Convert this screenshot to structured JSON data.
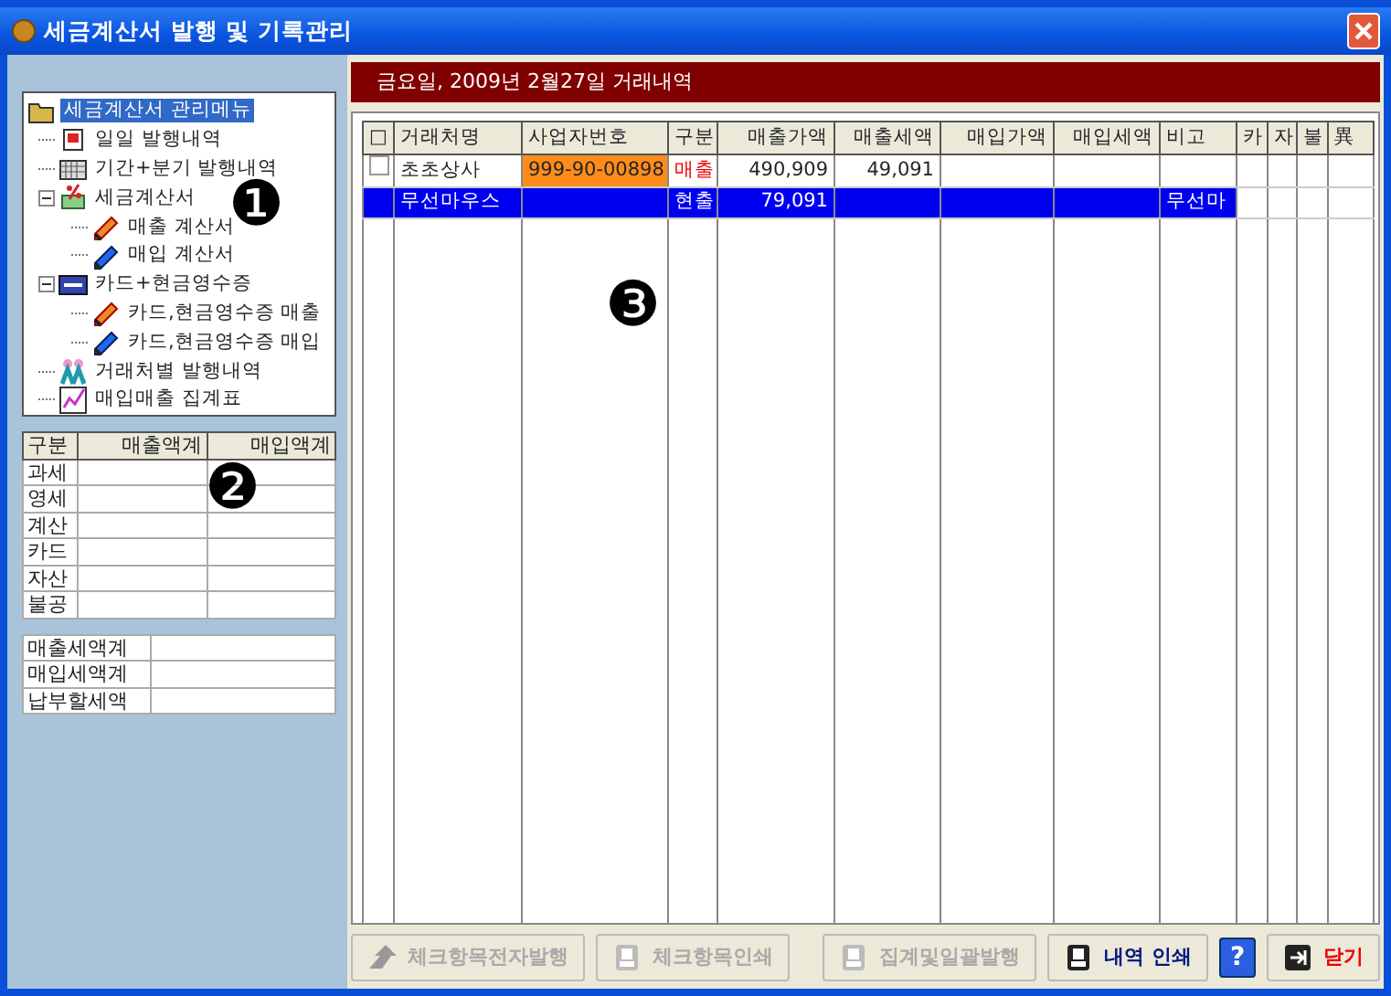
{
  "window": {
    "title": "세금계산서 발행 및 기록관리"
  },
  "tree": [
    {
      "label": "세금계산서 관리메뉴",
      "selected": true,
      "children": [
        {
          "label": "일일 발행내역",
          "selected": false
        },
        {
          "label": "기간+분기 발행내역",
          "selected": false
        },
        {
          "label": "세금계산서",
          "selected": false,
          "expanded": true,
          "children": [
            {
              "label": "매출 계산서",
              "selected": false
            },
            {
              "label": "매입 계산서",
              "selected": false
            }
          ]
        },
        {
          "label": "카드+현금영수증",
          "selected": false,
          "expanded": true,
          "children": [
            {
              "label": "카드,현금영수증 매출",
              "selected": false
            },
            {
              "label": "카드,현금영수증 매입",
              "selected": false
            }
          ]
        },
        {
          "label": "거래처별 발행내역",
          "selected": false
        },
        {
          "label": "매입매출 집계표",
          "selected": false
        }
      ]
    }
  ],
  "summary": {
    "columns": [
      "구분",
      "매출액계",
      "매입액계"
    ],
    "rows": [
      "과세",
      "영세",
      "계산",
      "카드",
      "자산",
      "불공"
    ]
  },
  "totals": [
    "매출세액계",
    "매입세액계",
    "납부할세액"
  ],
  "header": "금요일, 2009년 2월27일 거래내역",
  "table": {
    "columns": [
      "□",
      "거래처명",
      "사업자번호",
      "구분",
      "매출가액",
      "매출세액",
      "매입가액",
      "매입세액",
      "비고",
      "카",
      "자",
      "불",
      "異"
    ],
    "rows": [
      {
        "selected": false,
        "checked": false,
        "name": "초초상사",
        "bizno": "999-90-00898",
        "bizno_flagged": true,
        "type": "매출",
        "type_alert": true,
        "sales": "490,909",
        "sales_tax": "49,091"
      },
      {
        "selected": true,
        "name": "무선마우스",
        "type": "현출",
        "type_alert": false,
        "sales": "79,091",
        "note": "무선마"
      }
    ]
  },
  "markers": [
    "❶",
    "❷",
    "❸"
  ],
  "buttons": [
    {
      "label": "체크항목전자발행",
      "disabled": true
    },
    {
      "label": "체크항목인쇄",
      "disabled": true
    },
    {
      "label": "집계및일괄발행",
      "disabled": true
    },
    {
      "label": "내역 인쇄",
      "disabled": false
    },
    {
      "label": "?",
      "disabled": false
    },
    {
      "label": "닫기",
      "disabled": false
    }
  ]
}
